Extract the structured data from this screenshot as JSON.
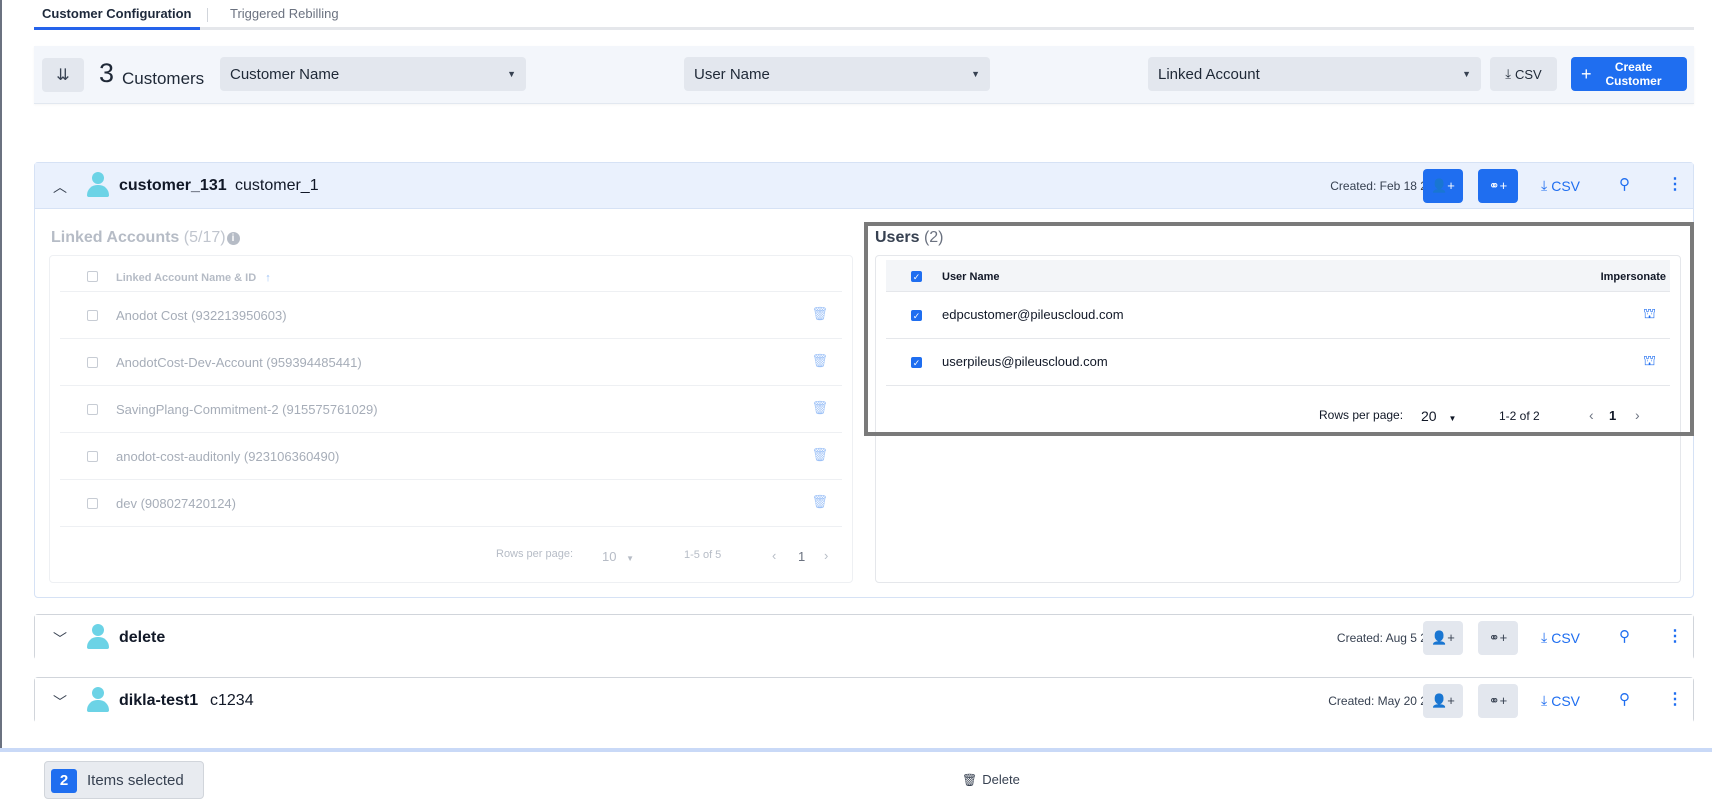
{
  "tabs": [
    {
      "label": "Customer Configuration",
      "active": true
    },
    {
      "label": "Triggered Rebilling",
      "active": false
    }
  ],
  "toolbar": {
    "count": "3",
    "count_label": "Customers",
    "filter_customer": "Customer Name",
    "filter_user": "User Name",
    "filter_linked": "Linked Account",
    "csv_label": "CSV",
    "create_label_line1": "Create",
    "create_label_line2": "Customer"
  },
  "customers": [
    {
      "name": "customer_131",
      "code": "customer_1",
      "created": "Created: Feb 18 2000",
      "csv_label": "CSV",
      "expanded": true
    },
    {
      "name": "delete",
      "code": "",
      "created": "Created: Aug 5 2025",
      "csv_label": "CSV",
      "expanded": false
    },
    {
      "name": "dikla-test1",
      "code": "c1234",
      "created": "Created: May 20 2025",
      "csv_label": "CSV",
      "expanded": false
    }
  ],
  "linked_accounts": {
    "title": "Linked Accounts",
    "count": "(5/17)",
    "column_header": "Linked Account Name & ID",
    "rows": [
      "Anodot Cost (932213950603)",
      "AnodotCost-Dev-Account (959394485441)",
      "SavingPlang-Commitment-2 (915575761029)",
      "anodot-cost-auditonly (923106360490)",
      "dev (908027420124)"
    ],
    "rows_per_page_label": "Rows per page:",
    "rows_per_page": "10",
    "range": "1-5 of 5",
    "page": "1"
  },
  "users": {
    "title": "Users",
    "count": "(2)",
    "column_user": "User Name",
    "column_impersonate": "Impersonate",
    "rows": [
      "edpcustomer@pileuscloud.com",
      "userpileus@pileuscloud.com"
    ],
    "rows_per_page_label": "Rows per page:",
    "rows_per_page": "20",
    "range": "1-2 of 2",
    "page": "1"
  },
  "bottom_bar": {
    "selected_count": "2",
    "selected_label": "Items selected",
    "delete_label": "Delete"
  },
  "colors": {
    "accent": "#1f6ef0",
    "avatar": "#6cd3e6",
    "highlight_border": "#7a7a7a"
  },
  "icons": [
    "collapse-all-icon",
    "caret-down-icon",
    "download-icon",
    "plus-icon",
    "chevron-up-icon",
    "chevron-down-icon",
    "user-avatar-icon",
    "add-user-icon",
    "link-account-icon",
    "zoom-icon",
    "more-vert-icon",
    "info-icon",
    "sort-up-icon",
    "trash-icon",
    "impersonate-icon",
    "chevron-left-icon",
    "chevron-right-icon"
  ]
}
